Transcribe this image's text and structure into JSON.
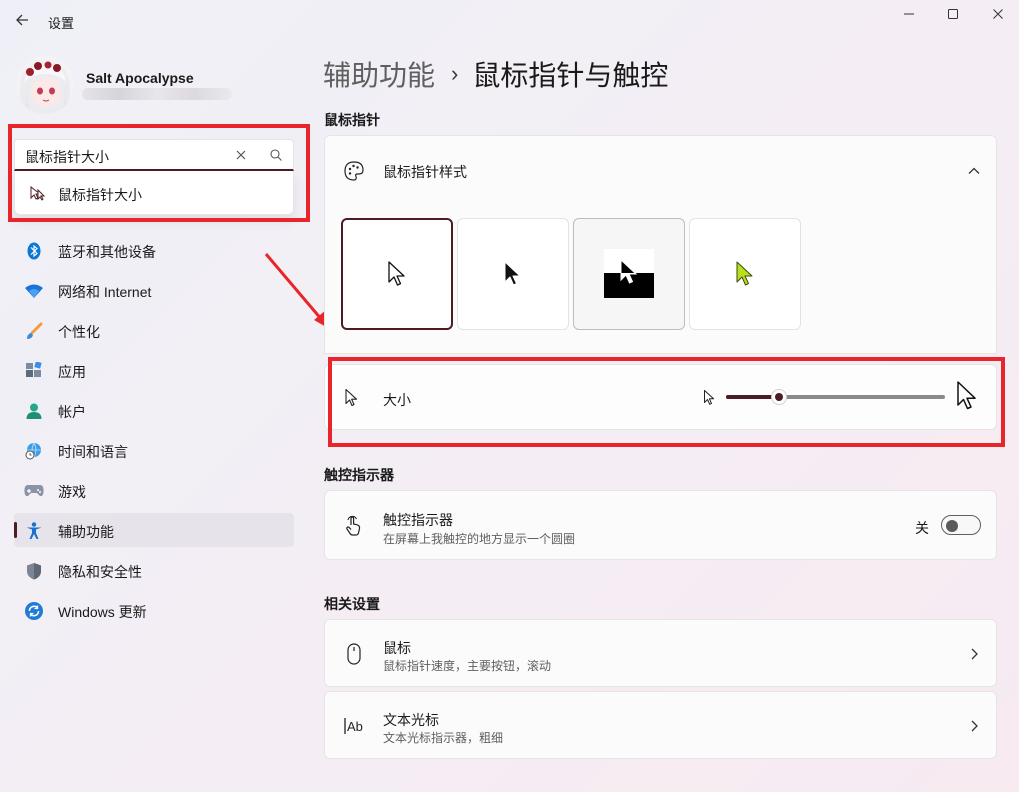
{
  "window": {
    "title": "设置",
    "buttons": {
      "minimize": "minimize-icon",
      "maximize": "maximize-icon",
      "close": "close-icon"
    }
  },
  "profile": {
    "name": "Salt Apocalypse"
  },
  "search": {
    "value": "鼠标指针大小",
    "suggestion": "鼠标指针大小"
  },
  "sidebar": {
    "items": [
      {
        "label": "蓝牙和其他设备",
        "icon": "bluetooth-icon"
      },
      {
        "label": "网络和 Internet",
        "icon": "wifi-icon"
      },
      {
        "label": "个性化",
        "icon": "brush-icon"
      },
      {
        "label": "应用",
        "icon": "apps-icon"
      },
      {
        "label": "帐户",
        "icon": "account-icon"
      },
      {
        "label": "时间和语言",
        "icon": "globe-clock-icon"
      },
      {
        "label": "游戏",
        "icon": "gamepad-icon"
      },
      {
        "label": "辅助功能",
        "icon": "accessibility-icon",
        "active": true
      },
      {
        "label": "隐私和安全性",
        "icon": "shield-icon"
      },
      {
        "label": "Windows 更新",
        "icon": "update-icon"
      }
    ]
  },
  "breadcrumb": {
    "parent": "辅助功能",
    "separator": "›",
    "current": "鼠标指针与触控"
  },
  "mouse_pointer": {
    "section_title": "鼠标指针",
    "style_label": "鼠标指针样式",
    "styles": [
      "white",
      "black",
      "inverted",
      "custom"
    ],
    "selected_style": "white",
    "custom_color": "#b8e01e",
    "size_label": "大小",
    "size_level": 0.24
  },
  "touch": {
    "section_title": "触控指示器",
    "title": "触控指示器",
    "subtitle": "在屏幕上我触控的地方显示一个圆圈",
    "state_label": "关",
    "enabled": false
  },
  "related": {
    "section_title": "相关设置",
    "items": [
      {
        "title": "鼠标",
        "subtitle": "鼠标指针速度，主要按钮，滚动",
        "icon": "mouse-icon"
      },
      {
        "title": "文本光标",
        "subtitle": "文本光标指示器，粗细",
        "icon": "text-cursor-icon"
      }
    ]
  },
  "colors": {
    "accent": "#4b1c22",
    "highlight_red": "#e8252b"
  }
}
